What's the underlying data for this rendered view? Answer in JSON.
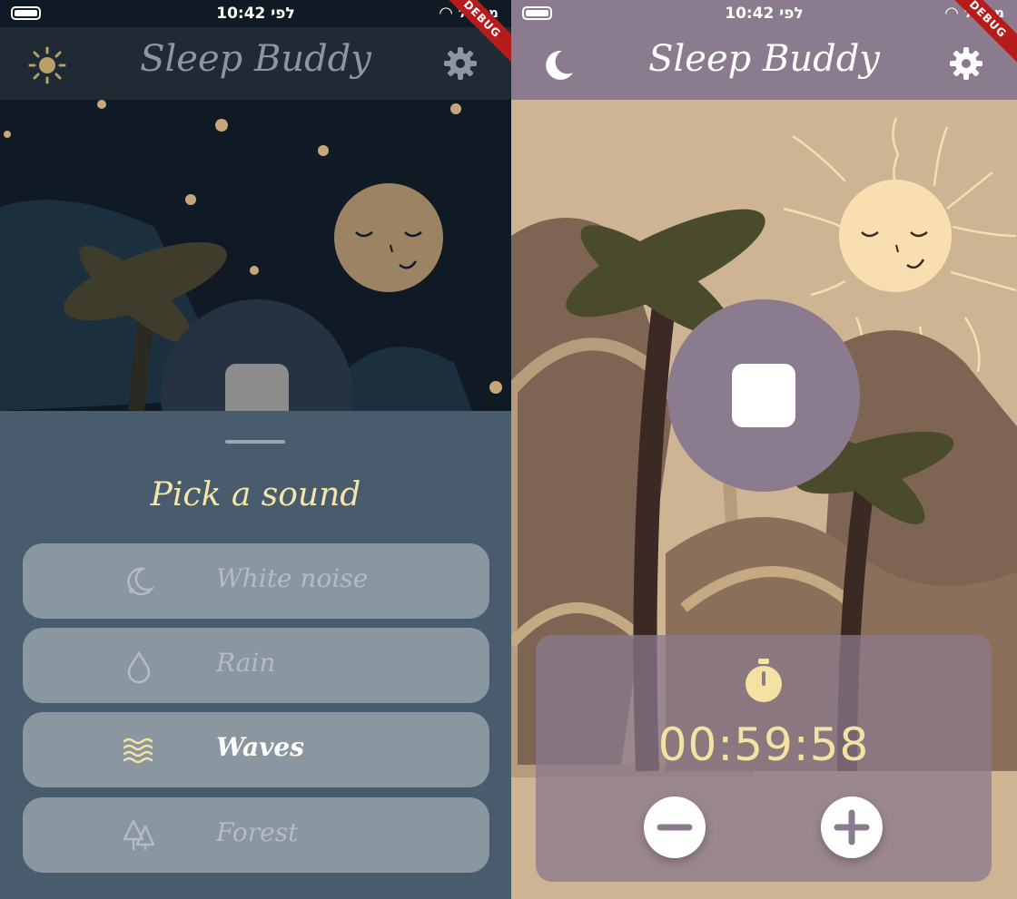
{
  "status_bar": {
    "time": "10:42 לפי",
    "carrier": "מפעיל",
    "debug_banner": "DEBUG"
  },
  "app": {
    "title": "Sleep Buddy"
  },
  "left_screen": {
    "mode_icon": "sun-icon",
    "settings_icon": "gear-icon",
    "sheet": {
      "heading": "Pick a sound",
      "sounds": [
        {
          "label": "White noise",
          "icon": "moon-icon",
          "selected": false
        },
        {
          "label": "Rain",
          "icon": "raindrop-icon",
          "selected": false
        },
        {
          "label": "Waves",
          "icon": "waves-icon",
          "selected": true
        },
        {
          "label": "Forest",
          "icon": "trees-icon",
          "selected": false
        }
      ]
    }
  },
  "right_screen": {
    "mode_icon": "moon-icon",
    "settings_icon": "gear-icon",
    "timer": {
      "icon": "stopwatch-icon",
      "remaining": "00:59:58"
    },
    "controls": {
      "decrease": "minus-icon",
      "increase": "plus-icon",
      "play_state": "stop-icon"
    }
  },
  "colors": {
    "left_appbar": "#1f2a35",
    "left_sheet": "#485c6e",
    "right_appbar": "#8a7b8e",
    "right_background": "#cfb494",
    "accent_yellow": "#f4e2a2"
  }
}
